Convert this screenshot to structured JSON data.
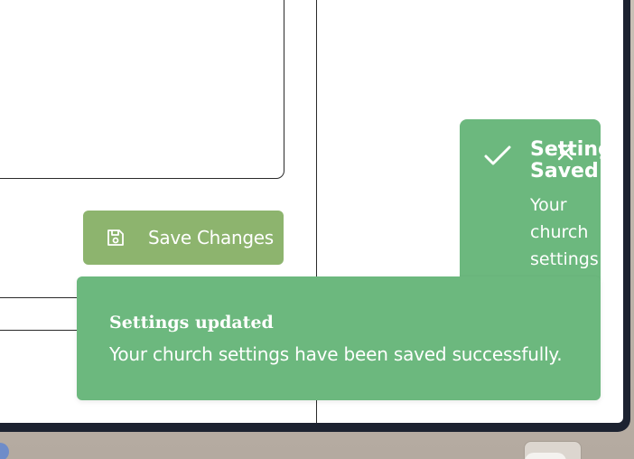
{
  "settings_page": {
    "save_button_label": "Save Changes"
  },
  "toast_saved": {
    "title": "Setting Saved",
    "message": "Your church settings"
  },
  "toast_updated": {
    "title": "Settings updated",
    "message": "Your church settings have been saved successfully."
  },
  "colors": {
    "button_green": "#8db46e",
    "toast_green": "#6cb87e",
    "text_white": "#ffffff"
  },
  "icons": {
    "save_button": "save-icon",
    "toast_saved_status": "checkmark-icon",
    "toast_saved_close": "close-icon"
  }
}
